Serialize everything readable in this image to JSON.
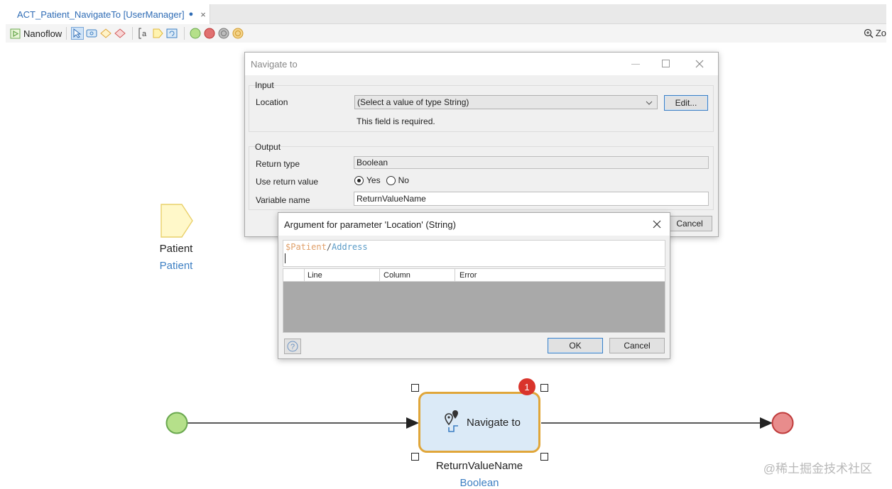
{
  "tab": {
    "title": "ACT_Patient_NavigateTo [UserManager]",
    "dirty": "●",
    "close": "×"
  },
  "toolbar": {
    "label": "Nanoflow",
    "zoom_label": "Zo"
  },
  "navigate_dialog": {
    "title": "Navigate to",
    "input_group": "Input",
    "location_label": "Location",
    "location_value": "(Select a value of type String)",
    "edit_button": "Edit...",
    "required_msg": "This field is required.",
    "output_group": "Output",
    "return_type_label": "Return type",
    "return_type_value": "Boolean",
    "use_return_label": "Use return value",
    "yes_label": "Yes",
    "no_label": "No",
    "variable_label": "Variable name",
    "variable_value": "ReturnValueName",
    "cancel_button": "Cancel"
  },
  "arg_dialog": {
    "title": "Argument for parameter 'Location' (String)",
    "expr_var": "$Patient",
    "expr_sep": "/",
    "expr_attr": "Address",
    "col_line": "Line",
    "col_column": "Column",
    "col_error": "Error",
    "ok_button": "OK",
    "cancel_button": "Cancel"
  },
  "canvas": {
    "param_name": "Patient",
    "param_type": "Patient",
    "action_label": "Navigate to",
    "action_badge": "1",
    "action_var": "ReturnValueName",
    "action_type": "Boolean"
  },
  "watermark": "@稀土掘金技术社区",
  "colors": {
    "accent_blue": "#3d7fc3",
    "start_green": "#b5e08a",
    "end_red": "#e88c8c",
    "action_border": "#e0a63a",
    "action_fill": "#dbeaf7",
    "badge_red": "#d9342b"
  }
}
